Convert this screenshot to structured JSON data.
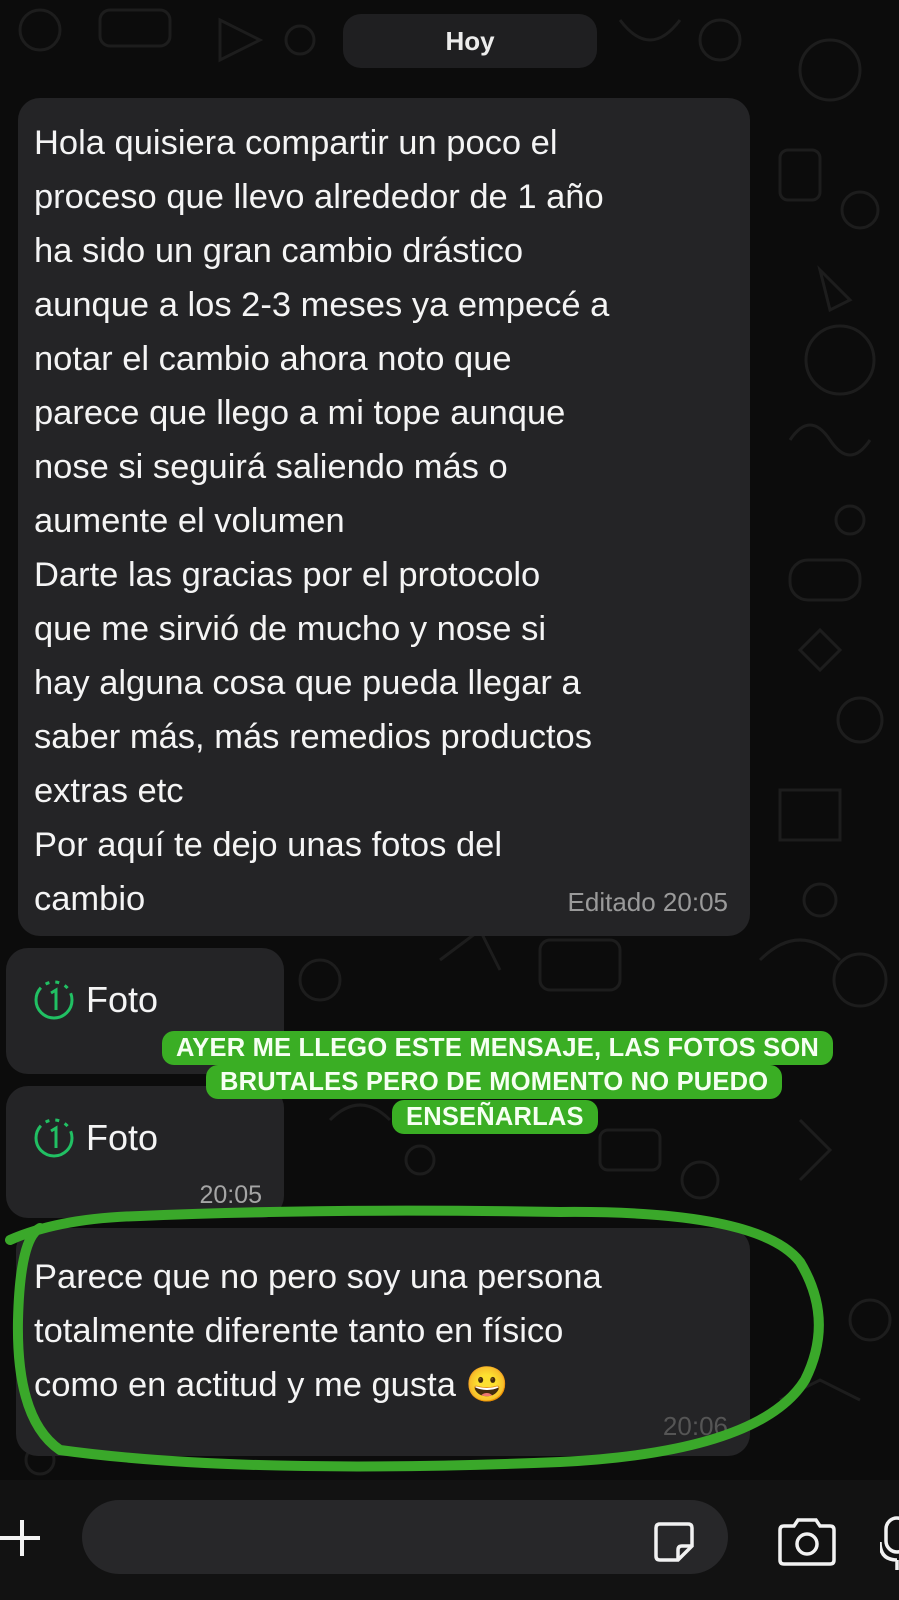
{
  "date_divider": "Hoy",
  "messages": {
    "first": {
      "text": "Hola quisiera compartir un poco el\nproceso que llevo alrededor de 1 año\nha sido un gran cambio drástico\naunque a los 2-3 meses ya empecé a\nnotar el cambio ahora noto que\nparece que llego a mi tope aunque\nnose si seguirá saliendo más o\naumente el volumen\nDarte las gracias por el protocolo\nque me sirvió de mucho y nose si\nhay alguna cosa que pueda llegar a\nsaber más, más remedios productos\nextras etc\nPor aquí te dejo unas fotos del\ncambio",
      "time": "Editado 20:05"
    },
    "photo_1": {
      "label": "Foto"
    },
    "photo_2": {
      "label": "Foto",
      "time": "20:05"
    },
    "last": {
      "text": "Parece que no pero soy una persona\ntotalmente diferente tanto en físico\ncomo en actitud y me gusta 😀",
      "time": "20:06"
    }
  },
  "overlay_caption": {
    "line1": "AYER ME LLEGO ESTE MENSAJE, LAS FOTOS SON",
    "line2": "BRUTALES PERO DE MOMENTO NO PUEDO",
    "line3": "ENSEÑARLAS"
  },
  "input": {
    "value": "",
    "placeholder": ""
  },
  "icons": {
    "view_once": "view-once-icon",
    "attach": "plus-icon",
    "sticker": "sticker-icon",
    "camera": "camera-icon",
    "mic": "microphone-icon"
  },
  "colors": {
    "background": "#0c0c0c",
    "bubble": "#242426",
    "accent_green": "#3aae24",
    "view_once_green": "#21c063",
    "timestamp": "#9a9a9a"
  }
}
